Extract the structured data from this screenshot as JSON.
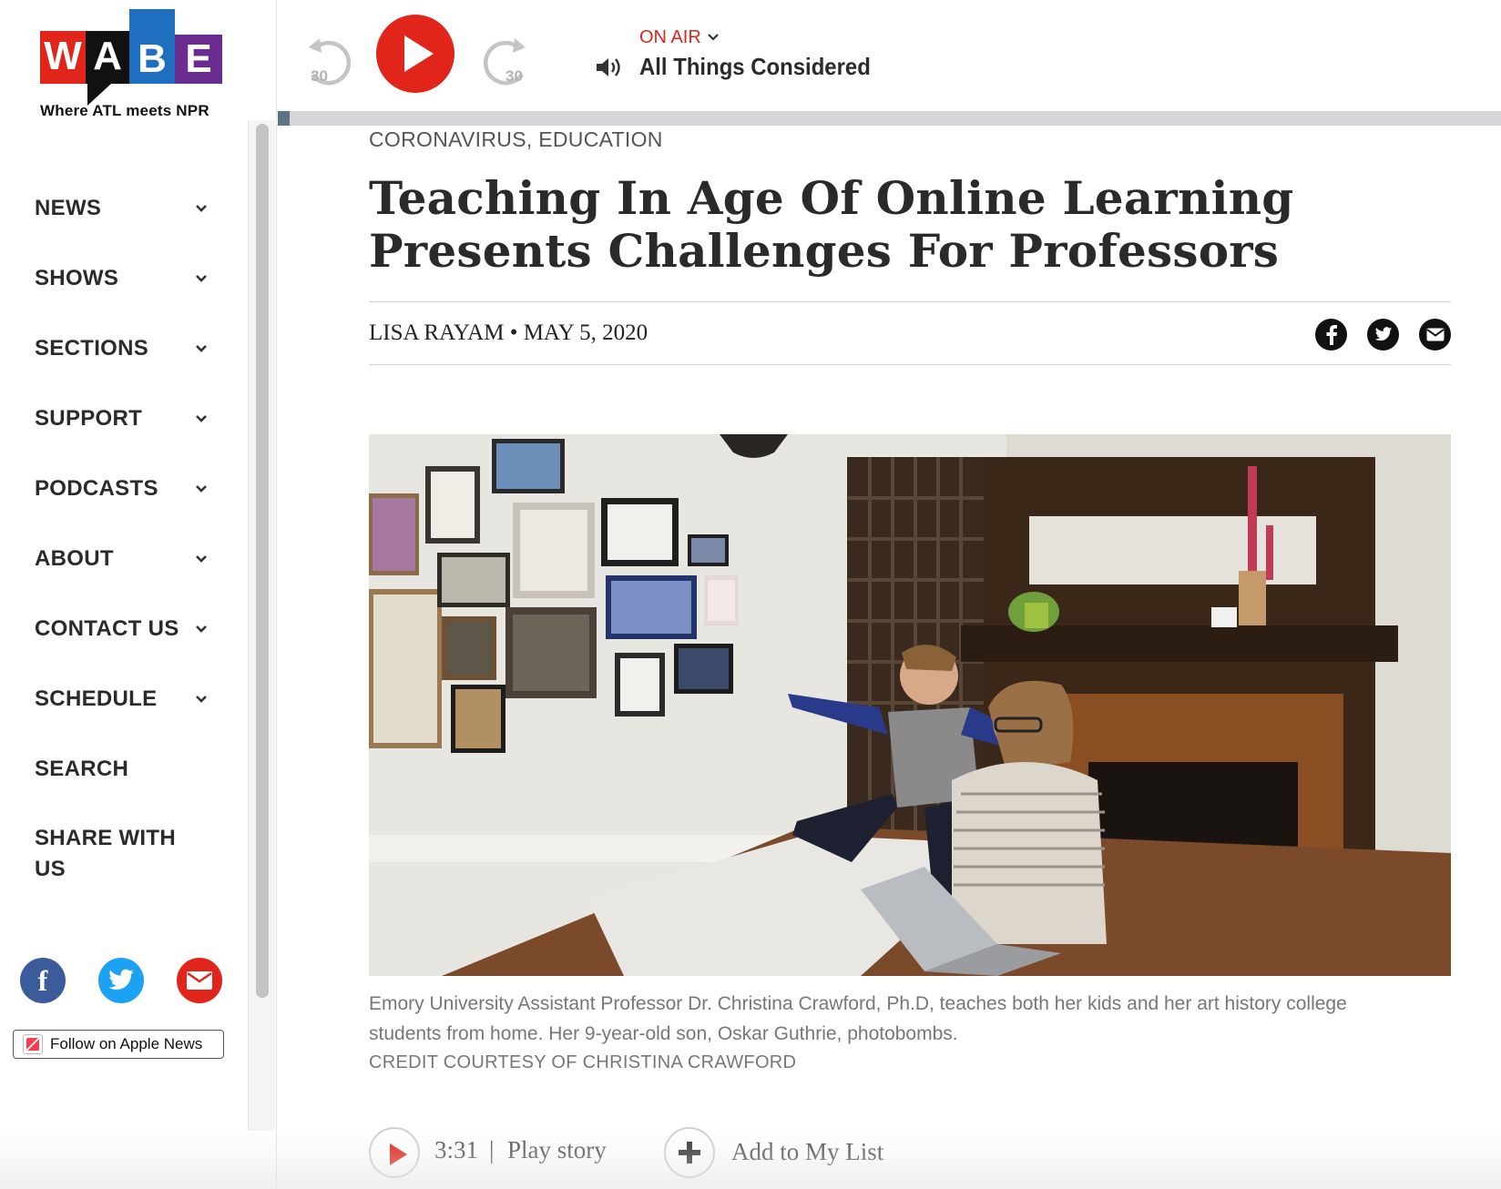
{
  "brand": {
    "letters": [
      "W",
      "A",
      "B",
      "E"
    ],
    "tagline": "Where ATL meets NPR",
    "colors": {
      "w": "#e1251b",
      "a": "#111111",
      "b": "#1f6fc1",
      "e": "#6a2c91"
    }
  },
  "player": {
    "skip_back": "30",
    "skip_forward": "30",
    "on_air": "ON AIR",
    "show": "All Things Considered",
    "accent": "#e1251b",
    "progress_fraction": 0.01
  },
  "nav": {
    "items": [
      {
        "label": "NEWS",
        "has_dropdown": true
      },
      {
        "label": "SHOWS",
        "has_dropdown": true
      },
      {
        "label": "SECTIONS",
        "has_dropdown": true
      },
      {
        "label": "SUPPORT",
        "has_dropdown": true
      },
      {
        "label": "PODCASTS",
        "has_dropdown": true
      },
      {
        "label": "ABOUT",
        "has_dropdown": true
      },
      {
        "label": "CONTACT US",
        "has_dropdown": true
      },
      {
        "label": "SCHEDULE",
        "has_dropdown": true
      },
      {
        "label": "SEARCH",
        "has_dropdown": false
      },
      {
        "label": "SHARE WITH US",
        "has_dropdown": false
      }
    ]
  },
  "social": {
    "icons": [
      "facebook-icon",
      "twitter-icon",
      "mail-icon"
    ],
    "apple_news": "Follow on Apple News"
  },
  "article": {
    "category_1": "CORONAVIRUS",
    "category_sep": ", ",
    "category_2": "EDUCATION",
    "headline": "Teaching In Age Of Online Learning Presents Challenges For Professors",
    "author": "LISA RAYAM",
    "byline_sep": " • ",
    "date": "MAY 5, 2020",
    "share_icons": [
      "facebook-icon",
      "twitter-icon",
      "email-icon"
    ],
    "caption": "Emory University Assistant Professor Dr. Christina Crawford, Ph.D, teaches both her kids and her art history college students from home. Her 9-year-old son, Oskar Guthrie, photobombs.",
    "credit": "CREDIT COURTESY OF CHRISTINA CRAWFORD"
  },
  "story": {
    "duration": "3:31",
    "separator": "|",
    "play_label": "Play story",
    "add_label": "Add to My List"
  }
}
